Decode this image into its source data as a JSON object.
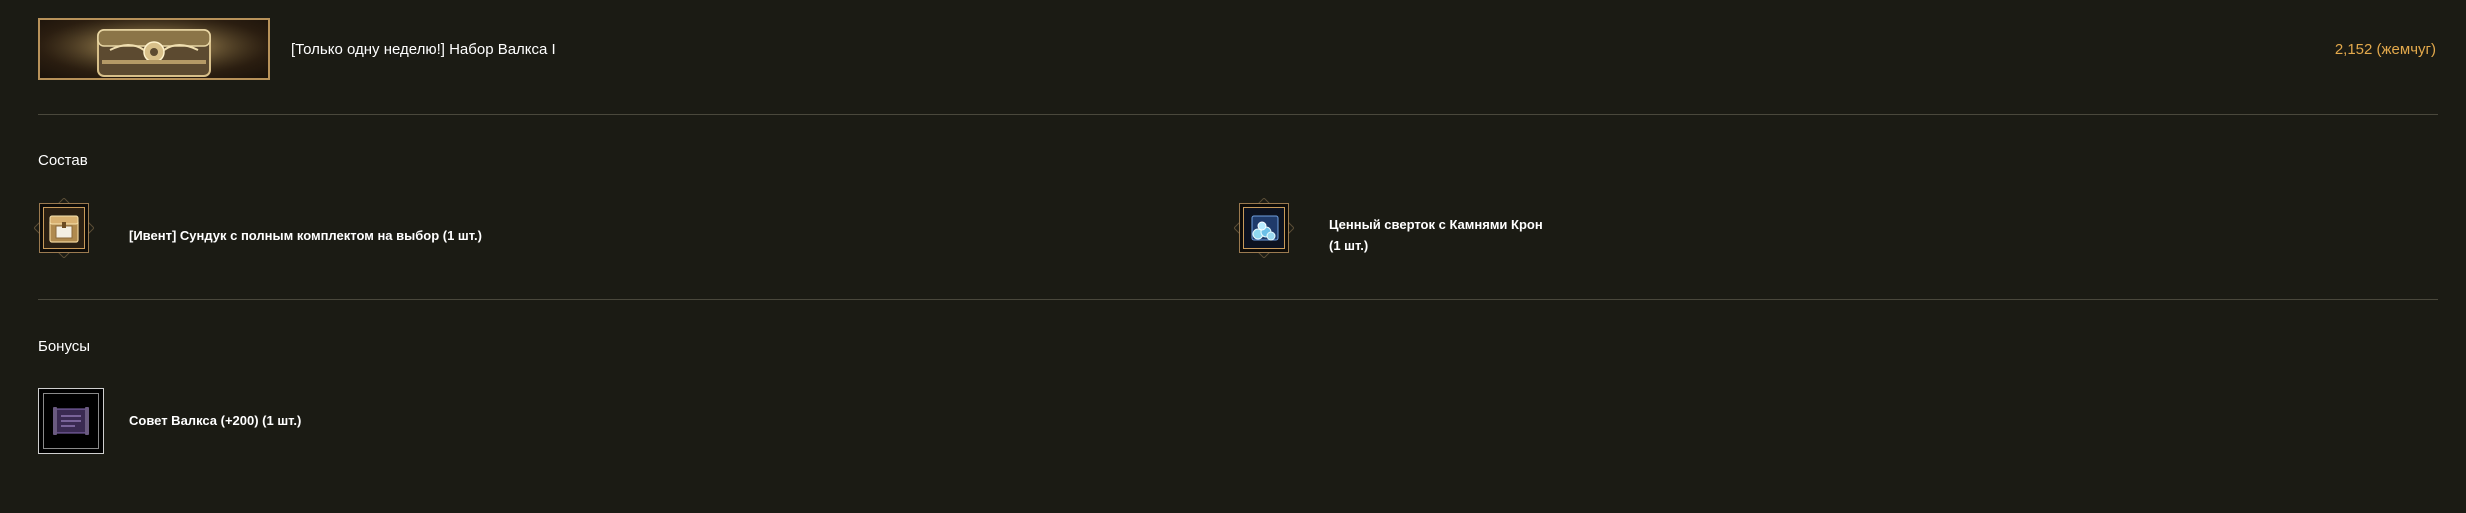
{
  "header": {
    "title": "[Только одну неделю!] Набор Валкса I",
    "price": "2,152 (жемчуг)"
  },
  "composition": {
    "title": "Состав",
    "items": [
      {
        "label": "[Ивент] Сундук с полным комплектом на выбор (1 шт.)",
        "icon": "event-chest-icon"
      },
      {
        "label_line1": "Ценный сверток с Камнями Крон",
        "label_line2": "(1 шт.)",
        "icon": "crown-stones-bundle-icon"
      }
    ]
  },
  "bonuses": {
    "title": "Бонусы",
    "items": [
      {
        "label": "Совет Валкса (+200) (1 шт.)",
        "icon": "valks-advice-scroll-icon"
      }
    ]
  },
  "colors": {
    "background": "#1b1b14",
    "price": "#e3a94c",
    "frame_gold": "#c79a5a",
    "divider": "#4a483c"
  }
}
